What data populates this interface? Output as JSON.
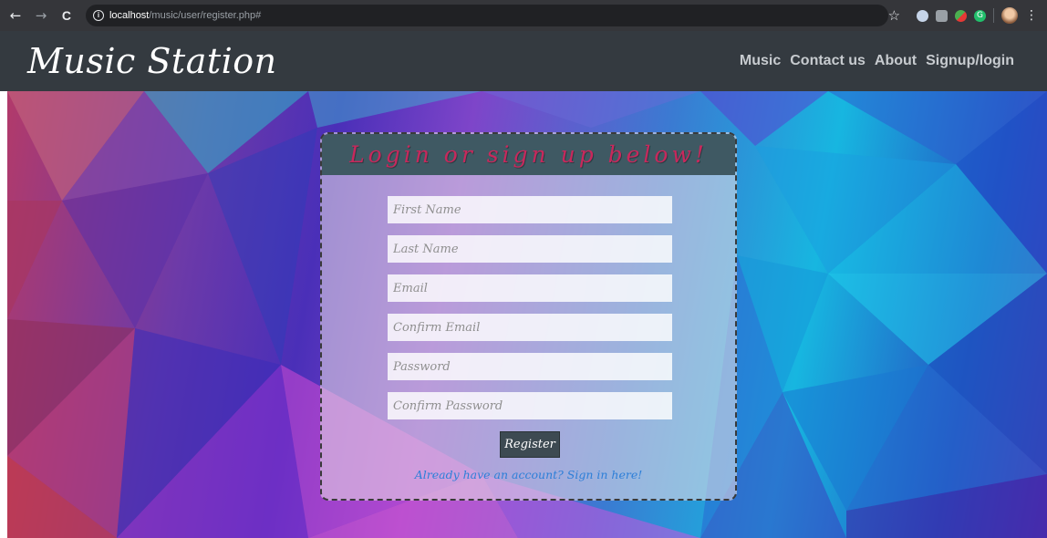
{
  "browser": {
    "back": "←",
    "forward": "→",
    "reload": "C",
    "url_host": "localhost",
    "url_path": "/music/user/register.php#",
    "star": "☆",
    "extension_g": "G",
    "menu": "⋮"
  },
  "site": {
    "brand": "Music Station",
    "nav": [
      "Music",
      "Contact us",
      "About",
      "Signup/login"
    ]
  },
  "form": {
    "title": "Login or sign up below!",
    "fields": [
      "First Name",
      "Last Name",
      "Email",
      "Confirm Email",
      "Password",
      "Confirm Password"
    ],
    "register_label": "Register",
    "signin_link": "Already have an account? Sign in here!"
  }
}
